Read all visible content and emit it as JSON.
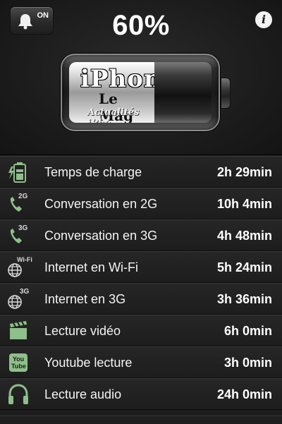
{
  "header": {
    "alarm_state": "ON",
    "battery_percent_text": "60%",
    "battery_level": 0.6,
    "info_label": "i",
    "logo": {
      "line1": "iPhon",
      "line2": "Le Mag",
      "line3": "Actualités iPho"
    }
  },
  "list": {
    "rows": [
      {
        "icon": "battery-charging-icon",
        "badge": "",
        "label": "Temps de charge",
        "value": "2h 29min"
      },
      {
        "icon": "phone-icon",
        "badge": "2G",
        "label": "Conversation en 2G",
        "value": "10h 4min"
      },
      {
        "icon": "phone-icon",
        "badge": "3G",
        "label": "Conversation en 3G",
        "value": "4h 48min"
      },
      {
        "icon": "globe-icon",
        "badge": "Wi-Fi",
        "label": "Internet en Wi-Fi",
        "value": "5h 24min"
      },
      {
        "icon": "globe-icon",
        "badge": "3G",
        "label": "Internet en 3G",
        "value": "3h 36min"
      },
      {
        "icon": "clapperboard-icon",
        "badge": "",
        "label": "Lecture vidéo",
        "value": "6h 0min"
      },
      {
        "icon": "youtube-icon",
        "badge": "You Tube",
        "label": "Youtube lecture",
        "value": "3h 0min"
      },
      {
        "icon": "headphones-icon",
        "badge": "",
        "label": "Lecture audio",
        "value": "24h 0min"
      }
    ]
  },
  "colors": {
    "background": "#1d1d1d",
    "icon_green": "#8fbf8a",
    "text": "#ffffff"
  }
}
